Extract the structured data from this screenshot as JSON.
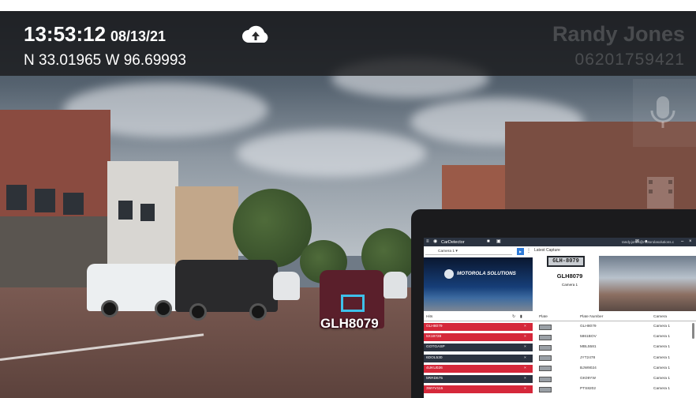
{
  "hud": {
    "time": "13:53:12",
    "date": "08/13/21",
    "gps": "N 33.01965 W 96.69993",
    "officer_name": "Randy Jones",
    "officer_id": "06201759421",
    "cloud_icon": "cloud-upload-icon",
    "mic_icon": "microphone-icon",
    "film_icon": "film-icon",
    "detected_plate": "GLH8079"
  },
  "app": {
    "title": "CarDetector",
    "user": "randy.jones@motorolasolutions.c",
    "camera_select": "Camera 1",
    "live_logo_text": "MOTOROLA SOLUTIONS",
    "latest_capture_label": "Latest Capture",
    "capture_plate_image_text": "GLH-8079",
    "capture_plate_number": "GLH8079",
    "capture_camera": "Camera 1",
    "list_headers": {
      "hits": "Hits",
      "plate": "Plate",
      "plate_number": "Plate Number",
      "camera": "Camera"
    },
    "hits": [
      {
        "plate": "GLH8079",
        "color": "#d5283a"
      },
      {
        "plate": "5X19728",
        "color": "#d5283a"
      },
      {
        "plate": "GOTGASP",
        "color": "#2b3340"
      },
      {
        "plate": "6DOL530",
        "color": "#2b3340"
      },
      {
        "plate": "4UKU026",
        "color": "#d5283a"
      },
      {
        "plate": "5RRD675",
        "color": "#2b3340"
      },
      {
        "plate": "3WYV115",
        "color": "#d5283a"
      }
    ],
    "reads": [
      {
        "number": "GLH8079",
        "camera": "Camera 1"
      },
      {
        "number": "5861BOV",
        "camera": "Camera 1"
      },
      {
        "number": "MBL5581",
        "camera": "Camera 1"
      },
      {
        "number": "JYT2478",
        "camera": "Camera 1"
      },
      {
        "number": "BJW9024",
        "camera": "Camera 1"
      },
      {
        "number": "GK09YW",
        "camera": "Camera 1"
      },
      {
        "number": "PTS8202",
        "camera": "Camera 1"
      }
    ],
    "remove_glyph": "×"
  },
  "colors": {
    "accent_blue": "#3ec0ea",
    "hit_red": "#d5283a",
    "hit_dark": "#2b3340"
  }
}
